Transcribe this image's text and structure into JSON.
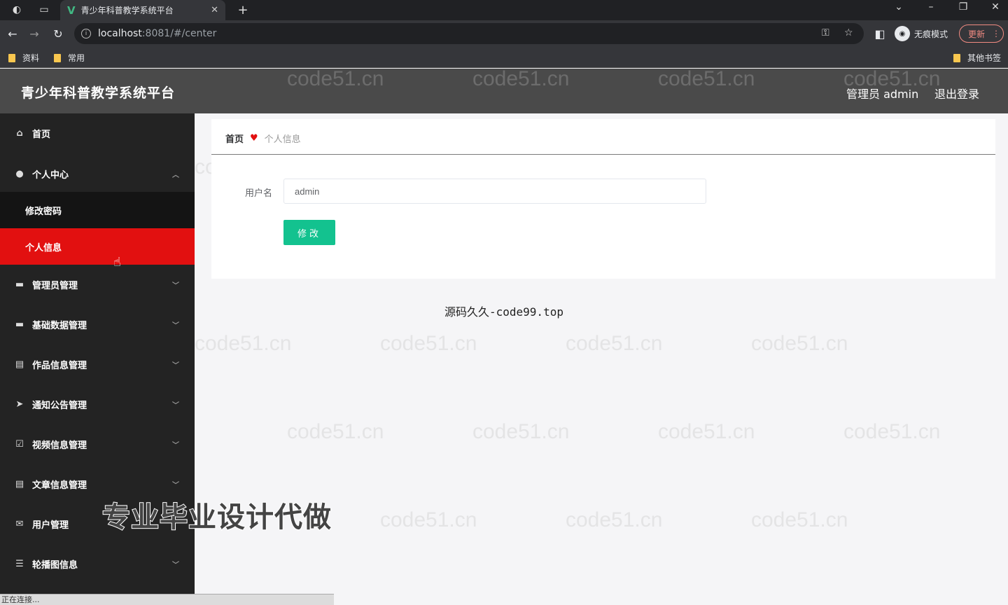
{
  "browser": {
    "tab_title": "青少年科普教学系统平台",
    "tab_favicon": "V",
    "url_host": "localhost",
    "url_path": ":8081/#/center",
    "incognito_label": "无痕模式",
    "update_label": "更新",
    "bookmarks": [
      "资料",
      "常用"
    ],
    "other_bookmarks": "其他书签"
  },
  "header": {
    "title": "青少年科普教学系统平台",
    "user_label": "管理员 admin",
    "logout_label": "退出登录"
  },
  "sidebar": {
    "items": [
      {
        "label": "首页",
        "icon": "home-icon"
      },
      {
        "label": "个人中心",
        "icon": "user-icon"
      },
      {
        "label": "修改密码"
      },
      {
        "label": "个人信息"
      },
      {
        "label": "管理员管理",
        "icon": "briefcase-icon"
      },
      {
        "label": "基础数据管理",
        "icon": "monitor-icon"
      },
      {
        "label": "作品信息管理",
        "icon": "card-icon"
      },
      {
        "label": "通知公告管理",
        "icon": "send-icon"
      },
      {
        "label": "视频信息管理",
        "icon": "check-icon"
      },
      {
        "label": "文章信息管理",
        "icon": "document-icon"
      },
      {
        "label": "用户管理",
        "icon": "mail-icon"
      },
      {
        "label": "轮播图信息",
        "icon": "sliders-icon"
      }
    ]
  },
  "breadcrumb": {
    "home": "首页",
    "current": "个人信息"
  },
  "form": {
    "username_label": "用户名",
    "username_value": "admin",
    "submit_label": "修改"
  },
  "overlay": {
    "source_note": "源码久久-code99.top",
    "watermark": "code51.cn",
    "promo": "专业毕业设计代做"
  },
  "status_bar": "正在连接..."
}
